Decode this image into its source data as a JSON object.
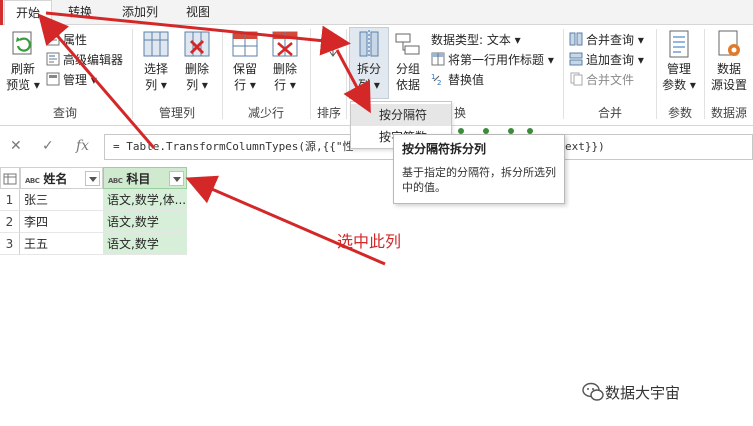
{
  "tabs": [
    {
      "label": "开始",
      "active": true
    },
    {
      "label": "转换",
      "active": false
    },
    {
      "label": "添加列",
      "active": false
    },
    {
      "label": "视图",
      "active": false
    }
  ],
  "ribbon": {
    "query": {
      "refresh_line1": "刷新",
      "refresh_line2": "预览",
      "properties": "属性",
      "advanced_editor": "高级编辑器",
      "manage": "管理",
      "group_label": "查询"
    },
    "manage_columns": {
      "choose_line1": "选择",
      "choose_line2": "列",
      "remove_line1": "删除",
      "remove_line2": "列",
      "group_label": "管理列"
    },
    "reduce_rows": {
      "keep_line1": "保留",
      "keep_line2": "行",
      "remove_line1": "删除",
      "remove_line2": "行",
      "group_label": "减少行"
    },
    "sort": {
      "group_label": "排序"
    },
    "transform": {
      "split_line1": "拆分",
      "split_line2": "列",
      "groupby_line1": "分组",
      "groupby_line2": "依据",
      "data_type": "数据类型: 文本",
      "first_row_header": "将第一行用作标题",
      "replace_values": "替换值",
      "group_label": "换"
    },
    "combine": {
      "merge_queries": "合并查询",
      "append_queries": "追加查询",
      "combine_files": "合并文件",
      "group_label": "合并"
    },
    "parameters": {
      "manage_line1": "管理",
      "manage_line2": "参数",
      "group_label": "参数"
    },
    "data_sources": {
      "settings_line1": "数据",
      "settings_line2": "源设置",
      "group_label": "数据源"
    }
  },
  "formula_bar": {
    "fx_label": "fx",
    "formula_left": "= Table.TransformColumnTypes(源,{{\"性",
    "formula_right": "ext}})"
  },
  "split_menu": {
    "items": [
      "按分隔符",
      "按字符数"
    ]
  },
  "tooltip": {
    "title": "按分隔符拆分列",
    "body": "基于指定的分隔符，拆分所选列中的值。"
  },
  "table": {
    "columns": [
      "姓名",
      "科目"
    ],
    "column_type_tag": "ABC",
    "rows": [
      {
        "index": "1",
        "name": "张三",
        "subject": "语文,数学,体..."
      },
      {
        "index": "2",
        "name": "李四",
        "subject": "语文,数学"
      },
      {
        "index": "3",
        "name": "王五",
        "subject": "语文,数学"
      }
    ]
  },
  "annotation": {
    "text": "选中此列",
    "color": "#d42828"
  },
  "watermark": {
    "text": "数据大宇宙"
  },
  "colors": {
    "accent_red": "#d22f2f",
    "selected_column": "#d7efd9",
    "highlight_button": "#e2e8ef"
  }
}
